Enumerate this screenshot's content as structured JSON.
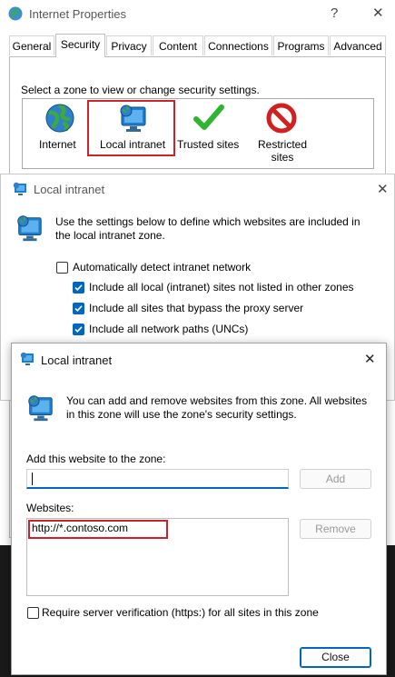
{
  "internet_properties": {
    "title": "Internet Properties",
    "help_glyph": "?",
    "close_glyph": "✕",
    "tabs": [
      {
        "label": "General"
      },
      {
        "label": "Security"
      },
      {
        "label": "Privacy"
      },
      {
        "label": "Content"
      },
      {
        "label": "Connections"
      },
      {
        "label": "Programs"
      },
      {
        "label": "Advanced"
      }
    ],
    "zone_prompt": "Select a zone to view or change security settings.",
    "zones": [
      {
        "label": "Internet",
        "icon": "globe-icon"
      },
      {
        "label": "Local intranet",
        "icon": "monitor-globe-icon"
      },
      {
        "label": "Trusted sites",
        "icon": "checkmark-icon"
      },
      {
        "label": "Restricted sites",
        "icon": "prohibited-icon"
      }
    ]
  },
  "local_intranet": {
    "title": "Local intranet",
    "close_glyph": "✕",
    "description": "Use the settings below to define which websites are included in the local intranet zone.",
    "options": [
      {
        "label": "Automatically detect intranet network",
        "checked": false
      },
      {
        "label": "Include all local (intranet) sites not listed in other zones",
        "checked": true
      },
      {
        "label": "Include all sites that bypass the proxy server",
        "checked": true
      },
      {
        "label": "Include all network paths (UNCs)",
        "checked": true
      }
    ]
  },
  "sites_dialog": {
    "title": "Local intranet",
    "close_glyph": "✕",
    "description": "You can add and remove websites from this zone. All websites in this zone will use the zone's security settings.",
    "add_label": "Add this website to the zone:",
    "add_value": "",
    "add_button": "Add",
    "websites_label": "Websites:",
    "websites": [
      "http://*.contoso.com"
    ],
    "remove_button": "Remove",
    "require_https_label": "Require server verification (https:) for all sites in this zone",
    "require_https_checked": false,
    "close_button": "Close"
  },
  "colors": {
    "highlight_box": "#d0202a",
    "checkbox_accent": "#0067c0"
  }
}
